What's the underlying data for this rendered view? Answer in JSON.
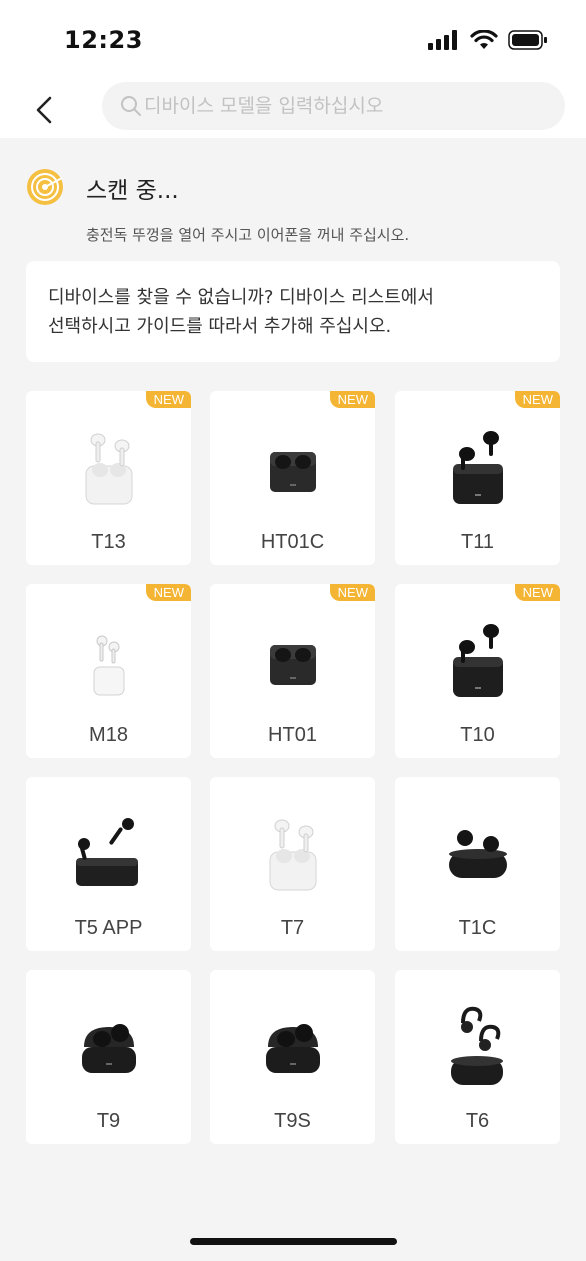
{
  "status_bar": {
    "time": "12:23"
  },
  "search": {
    "placeholder": "디바이스 모델을 입력하십시오"
  },
  "scan": {
    "title": "스캔 중...",
    "subtitle": "충전독 뚜껑을 열어 주시고 이어폰을 꺼내 주십시오."
  },
  "notice": {
    "line1": "디바이스를 찾을 수 없습니까? 디바이스 리스트에서",
    "line2": "선택하시고 가이드를 따라서 추가해 주십시오."
  },
  "devices": [
    {
      "name": "T13",
      "badge": "NEW",
      "style": "white-stem"
    },
    {
      "name": "HT01C",
      "badge": "NEW",
      "style": "black-square"
    },
    {
      "name": "T11",
      "badge": "NEW",
      "style": "black-stem"
    },
    {
      "name": "M18",
      "badge": "NEW",
      "style": "white-small"
    },
    {
      "name": "HT01",
      "badge": "NEW",
      "style": "black-square"
    },
    {
      "name": "T10",
      "badge": "NEW",
      "style": "black-stem"
    },
    {
      "name": "T5 APP",
      "badge": "",
      "style": "black-wide"
    },
    {
      "name": "T7",
      "badge": "",
      "style": "white-stem"
    },
    {
      "name": "T1C",
      "badge": "",
      "style": "black-pill"
    },
    {
      "name": "T9",
      "badge": "",
      "style": "black-round"
    },
    {
      "name": "T9S",
      "badge": "",
      "style": "black-round"
    },
    {
      "name": "T6",
      "badge": "",
      "style": "sport-hook"
    }
  ],
  "colors": {
    "accent": "#f5b534",
    "background": "#f4f4f4",
    "card": "#ffffff"
  }
}
